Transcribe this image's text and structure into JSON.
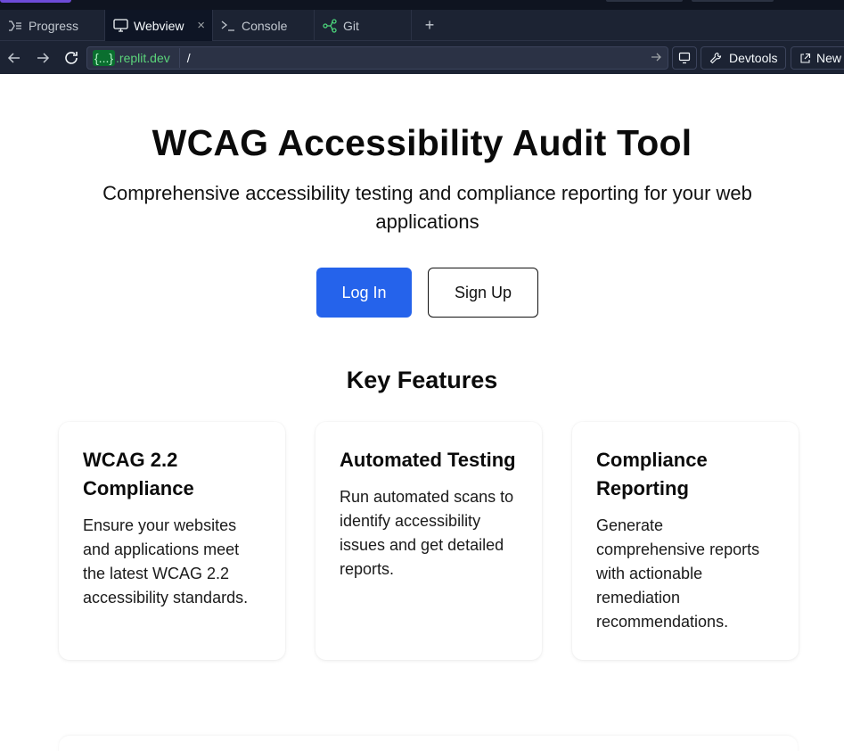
{
  "ide": {
    "tabs": [
      {
        "label": "Progress",
        "icon": "progress-icon"
      },
      {
        "label": "Webview",
        "icon": "monitor-icon",
        "close": "×"
      },
      {
        "label": "Console",
        "icon": "terminal-icon"
      },
      {
        "label": "Git",
        "icon": "git-branch-icon"
      }
    ],
    "add_tab": "+",
    "url": {
      "domain_badge": "{...}",
      "domain": ".replit.dev",
      "path": "/"
    },
    "devtools_label": "Devtools",
    "new_tab_label": "New t"
  },
  "hero": {
    "title": "WCAG Accessibility Audit Tool",
    "subtitle": "Comprehensive accessibility testing and compliance reporting for your web applications",
    "login_label": "Log In",
    "signup_label": "Sign Up"
  },
  "features": {
    "heading": "Key Features",
    "items": [
      {
        "title": "WCAG 2.2 Compliance",
        "description": "Ensure your websites and applications meet the latest WCAG 2.2 accessibility standards."
      },
      {
        "title": "Automated Testing",
        "description": "Run automated scans to identify accessibility issues and get detailed reports."
      },
      {
        "title": "Compliance Reporting",
        "description": "Generate comprehensive reports with actionable remediation recommendations."
      }
    ]
  },
  "colors": {
    "primary": "#2563eb",
    "ide_bg": "#1c2333",
    "ide_active": "#0e1525",
    "domain_green": "#5bd47a"
  }
}
